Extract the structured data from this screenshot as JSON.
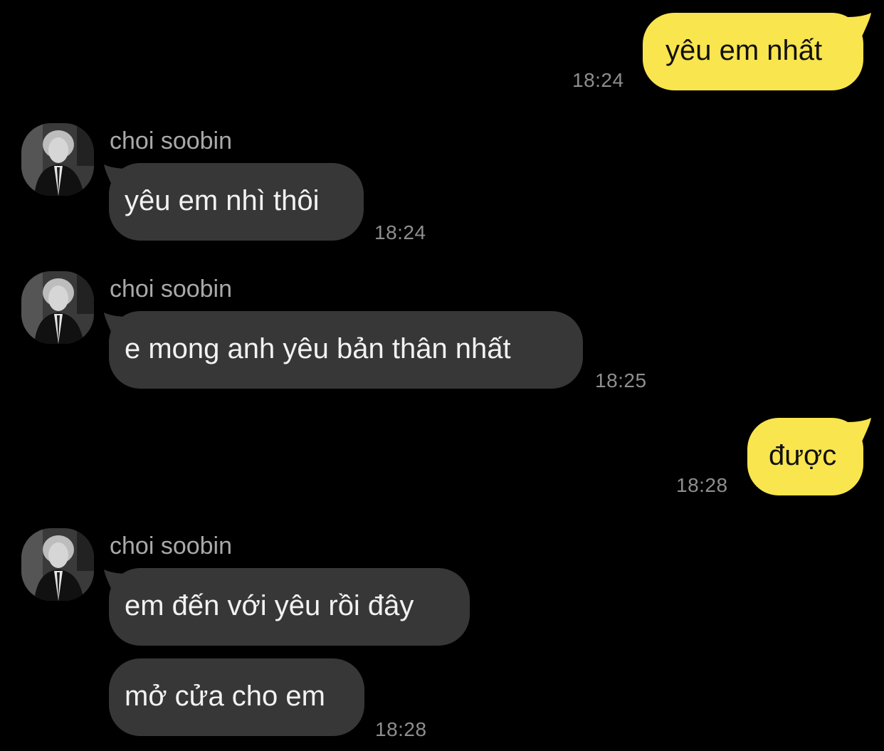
{
  "colors": {
    "background": "#000000",
    "outgoing_bubble": "#F9E54E",
    "incoming_bubble": "#373737",
    "timestamp": "#8E8E8E",
    "sender_name": "#A9A9A9"
  },
  "messages": [
    {
      "direction": "outgoing",
      "text": "yêu em nhất",
      "time": "18:24"
    },
    {
      "direction": "incoming",
      "sender": "choi soobin",
      "avatar": "profile-photo",
      "text": "yêu em nhì thôi",
      "time": "18:24"
    },
    {
      "direction": "incoming",
      "sender": "choi soobin",
      "avatar": "profile-photo",
      "text": "e mong anh yêu bản thân nhất",
      "time": "18:25"
    },
    {
      "direction": "outgoing",
      "text": "được",
      "time": "18:28"
    },
    {
      "direction": "incoming",
      "sender": "choi soobin",
      "avatar": "profile-photo",
      "text": "em đến với yêu rồi đây"
    },
    {
      "direction": "incoming",
      "text": "mở cửa cho em",
      "time": "18:28"
    }
  ]
}
